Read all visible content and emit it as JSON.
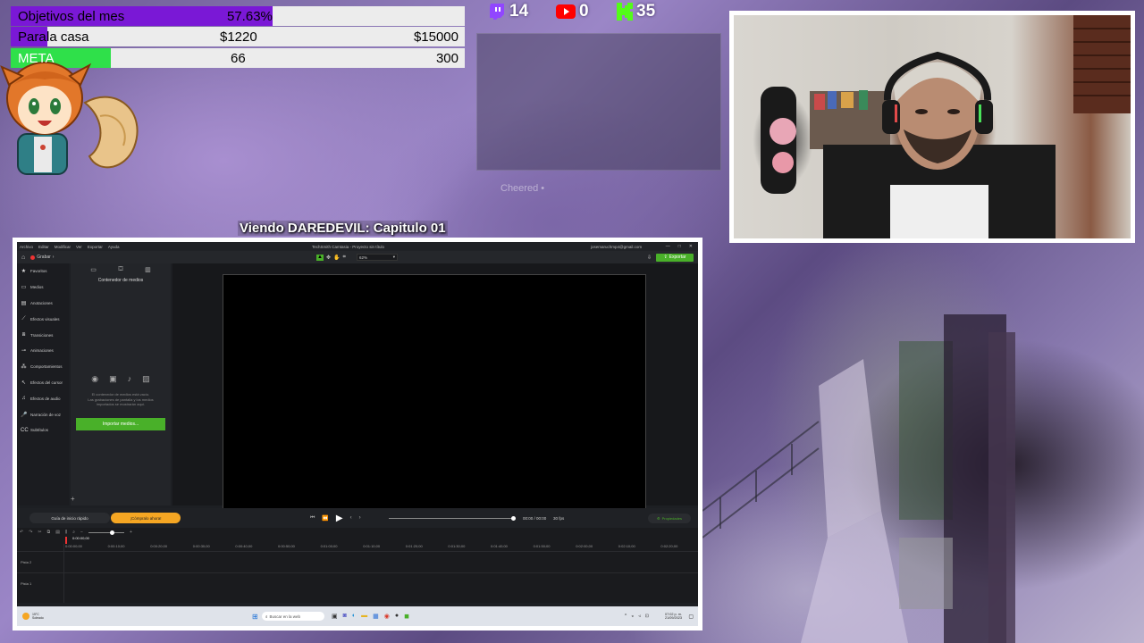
{
  "overlay": {
    "goals": [
      {
        "label": "Objetivos del mes",
        "value": "57.63%",
        "progress": 0.5763,
        "fill": "#7a18d6"
      },
      {
        "label_a": "Para",
        "label_b": " la casa",
        "current": "$1220",
        "target": "$15000",
        "progress": 0.0813,
        "fill": "#7a18d6"
      },
      {
        "label": "META",
        "current": "66",
        "target": "300",
        "progress": 0.22,
        "fill": "#2fe04a"
      }
    ],
    "stats": {
      "twitch": "14",
      "youtube": "0",
      "kick": "35"
    },
    "cheer_text": "Cheered •",
    "now_watching": "Viendo DAREDEVIL: Capitulo 01"
  },
  "app": {
    "menu": [
      "Archivo",
      "Editar",
      "Modificar",
      "Ver",
      "Exportar",
      "Ayuda"
    ],
    "title": "TechSmith Camtasia - Proyecto sin título",
    "account": "josemaruchmp4@gmail.com",
    "export_label": "Exportar",
    "record_label": "Grabar",
    "zoom": "62%",
    "sidebar": [
      "Favoritos",
      "Medios",
      "Anotaciones",
      "Efectos visuales",
      "Transiciones",
      "Animaciones",
      "Comportamientos",
      "Efectos del cursor",
      "Efectos de audio",
      "Narración de voz",
      "Subtítulos"
    ],
    "bin_title": "Contenedor de medios",
    "bin_empty_line1": "El contenedor de medios está vacío.",
    "bin_empty_line2": "Las grabaciones de pantalla y los medios",
    "bin_empty_line3": "importados se mostrarán aquí.",
    "import_label": "Importar medios...",
    "guide_label": "Guía de inicio rápido",
    "buy_label": "¡Cómpralo ahora!",
    "time_display": "00:00 / 00:00",
    "fps": "30 fps",
    "properties_label": "Propiedades",
    "playhead": "0:00:00;00",
    "ruler": [
      "0:00:00;00",
      "0:00:10;00",
      "0:00:20;00",
      "0:00:30;00",
      "0:00:40;00",
      "0:00:50;00",
      "0:01:00;00",
      "0:01:10;00",
      "0:01:20;00",
      "0:01:30;00",
      "0:01:40;00",
      "0:01:50;00",
      "0:02:00;00",
      "0:02:10;00",
      "0:02:20;00"
    ],
    "tracks": [
      "Pista 2",
      "Pista 1"
    ],
    "weather_temp": "15°C",
    "weather_desc": "Soleado",
    "search_placeholder": "Buscar en la web",
    "clock_time": "07:02 p. m.",
    "clock_date": "21/09/2023",
    "accent": "#49b029"
  }
}
